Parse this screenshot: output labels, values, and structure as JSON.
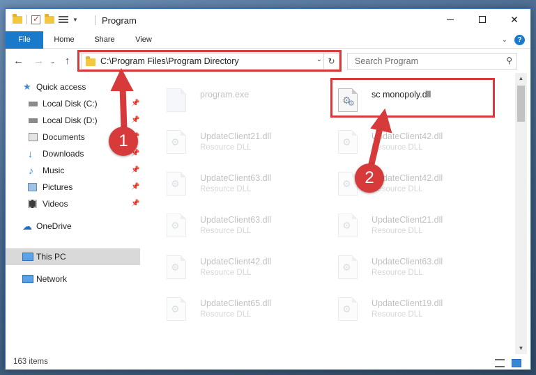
{
  "window": {
    "title": "Program"
  },
  "ribbon": {
    "tabs": [
      "File",
      "Home",
      "Share",
      "View"
    ]
  },
  "address": {
    "path": "C:\\Program Files\\Program Directory"
  },
  "search": {
    "placeholder": "Search Program"
  },
  "sidebar": {
    "items": [
      {
        "label": "Quick access",
        "icon": "star-icon"
      },
      {
        "label": "Local Disk (C:)",
        "icon": "drive-icon",
        "pinned": true
      },
      {
        "label": "Local Disk (D:)",
        "icon": "drive-icon",
        "pinned": true
      },
      {
        "label": "Documents",
        "icon": "documents-icon",
        "pinned": true
      },
      {
        "label": "Downloads",
        "icon": "download-icon",
        "pinned": true
      },
      {
        "label": "Music",
        "icon": "music-icon",
        "pinned": true
      },
      {
        "label": "Pictures",
        "icon": "pictures-icon",
        "pinned": true
      },
      {
        "label": "Videos",
        "icon": "videos-icon",
        "pinned": true
      },
      {
        "label": "OneDrive",
        "icon": "cloud-icon"
      },
      {
        "label": "This PC",
        "icon": "computer-icon",
        "selected": true
      },
      {
        "label": "Network",
        "icon": "network-icon"
      }
    ]
  },
  "files": {
    "highlighted": {
      "name": "sc monopoly.dll",
      "type": ""
    },
    "program": {
      "name": "program.exe",
      "type": ""
    },
    "left": [
      {
        "name": "UpdateClient21.dll",
        "type": "Resource DLL"
      },
      {
        "name": "UpdateClient63.dll",
        "type": "Resource DLL"
      },
      {
        "name": "UpdateClient63.dll",
        "type": "Resource DLL"
      },
      {
        "name": "UpdateClient42.dll",
        "type": "Resource DLL"
      },
      {
        "name": "UpdateClient65.dll",
        "type": "Resource DLL"
      }
    ],
    "right": [
      {
        "name": "UpdateClient42.dll",
        "type": "Resource DLL"
      },
      {
        "name": "UpdateClient42.dll",
        "type": "Resource DLL"
      },
      {
        "name": "UpdateClient21.dll",
        "type": "Resource DLL"
      },
      {
        "name": "UpdateClient63.dll",
        "type": "Resource DLL"
      },
      {
        "name": "UpdateClient19.dll",
        "type": "Resource DLL"
      }
    ]
  },
  "status": {
    "items_count": "163 items"
  },
  "callouts": {
    "one": "1",
    "two": "2"
  },
  "colors": {
    "accent": "#1979ca",
    "callout": "#d63a3a",
    "selected": "#d9d9d9"
  }
}
